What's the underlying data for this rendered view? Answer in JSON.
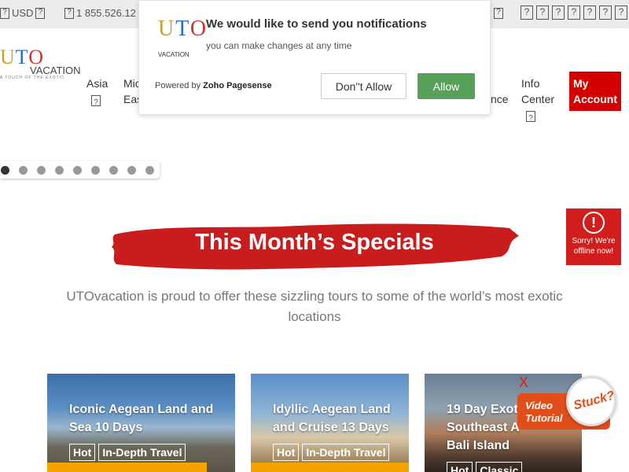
{
  "topbar": {
    "currency": "USD",
    "phone": "1 855.526.12"
  },
  "logo": {
    "main": "UTO",
    "sub": "VACATION",
    "tagline": "A TOUCH OF THE EXOTIC"
  },
  "nav": {
    "asia": "Asia",
    "middle_east_1": "Mic",
    "middle_east_2": "Eas",
    "partial": "nce",
    "info_1": "Info",
    "info_2": "Center",
    "account_1": "My",
    "account_2": "Account"
  },
  "slider": {
    "dot_count": 9,
    "active_index": 0
  },
  "hero": {
    "headline": "This Month’s Specials",
    "subtitle": "UTOvacation is proud to offer these sizzling tours to some of the world’s most exotic locations"
  },
  "cards": [
    {
      "title_1": "Iconic Aegean Land and",
      "title_2": "Sea 10 Days",
      "title_3": "",
      "tag_1": "Hot",
      "tag_2": "In-Depth Travel"
    },
    {
      "title_1": "Idyllic Aegean Land",
      "title_2": "and Cruise 13 Days",
      "title_3": "",
      "tag_1": "Hot",
      "tag_2": "In-Depth Travel"
    },
    {
      "title_1": "19 Day Exot",
      "title_2": "Southeast A",
      "title_3": "Bali Island",
      "tag_1": "Hot",
      "tag_2": "Classic"
    }
  ],
  "notification": {
    "logo_main": "UTO",
    "logo_sub": "VACATION",
    "title": "We would like to send you notifications",
    "message": "you can make changes at any time",
    "powered_by": "Powered by",
    "powered_brand": "Zoho Pagesense",
    "deny_label": "Don''t Allow",
    "allow_label": "Allow"
  },
  "offline_widget": {
    "icon": "!",
    "line_1": "Sorry! We're",
    "line_2": "offline now!"
  },
  "help_widget": {
    "close": "X",
    "video_1": "Video",
    "video_2": "Tutorial",
    "stuck": "Stuck?"
  },
  "colors": {
    "brand_red": "#d40000",
    "allow_green": "#58a05a",
    "price_orange": "#f5a300",
    "help_orange": "#e24e1a"
  }
}
